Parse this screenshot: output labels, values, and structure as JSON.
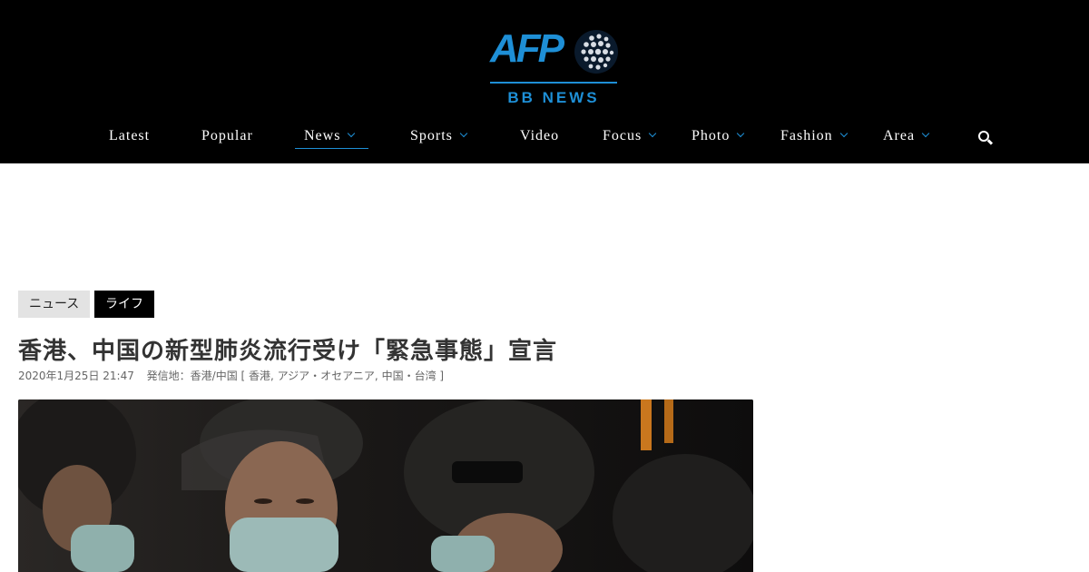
{
  "brand": {
    "logo_text": "AFP",
    "logo_subtitle": "BB NEWS",
    "accent_color": "#1e8fd6"
  },
  "nav": {
    "items": [
      {
        "label": "Latest",
        "dropdown": false
      },
      {
        "label": "Popular",
        "dropdown": false
      },
      {
        "label": "News",
        "dropdown": true,
        "active": true
      },
      {
        "label": "Sports",
        "dropdown": true
      },
      {
        "label": "Video",
        "dropdown": false
      },
      {
        "label": "Focus",
        "dropdown": true
      },
      {
        "label": "Photo",
        "dropdown": true
      },
      {
        "label": "Fashion",
        "dropdown": true
      },
      {
        "label": "Area",
        "dropdown": true
      }
    ],
    "search_icon": "search-icon"
  },
  "article": {
    "tags": [
      "ニュース",
      "ライフ"
    ],
    "title": "香港、中国の新型肺炎流行受け「緊急事態」宣言",
    "date": "2020年1月25日 21:47",
    "location": "発信地：香港/中国 [ 香港, アジア・オセアニア, 中国・台湾 ]"
  }
}
